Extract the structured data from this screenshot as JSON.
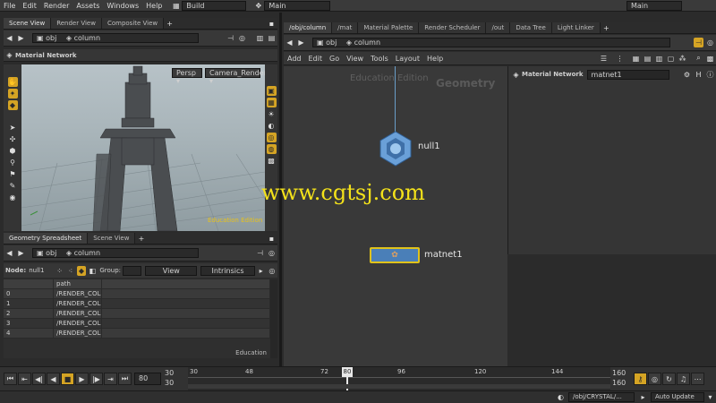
{
  "menubar": {
    "items": [
      "File",
      "Edit",
      "Render",
      "Assets",
      "Windows",
      "Help"
    ],
    "shelf_label": "Build",
    "desktop_label": "Main",
    "right_desktop_label": "Main"
  },
  "left_top": {
    "tabs": [
      "Scene View",
      "Render View",
      "Composite View"
    ],
    "path_label": "obj",
    "path_node": "column",
    "viewer_title": "Material Network",
    "persp_label": "Persp",
    "camera_label": "Camera_Render",
    "watermark": "Education Edition"
  },
  "left_bottom": {
    "tabs": [
      "Geometry Spreadsheet",
      "Scene View"
    ],
    "path_label": "obj",
    "path_node": "column",
    "node_label": "Node:",
    "node_value": "null1",
    "group_label": "Group:",
    "view_label": "View",
    "intrinsics_label": "Intrinsics",
    "column_header": "path",
    "rows": [
      {
        "index": "0",
        "path": "/RENDER_COL"
      },
      {
        "index": "1",
        "path": "/RENDER_COL"
      },
      {
        "index": "2",
        "path": "/RENDER_COL"
      },
      {
        "index": "3",
        "path": "/RENDER_COL"
      },
      {
        "index": "4",
        "path": "/RENDER_COL"
      }
    ],
    "footer": "Education"
  },
  "right": {
    "tabs": [
      "/obj/column",
      "/mat",
      "Material Palette",
      "Render Scheduler",
      "/out",
      "Data Tree",
      "Light Linker"
    ],
    "path_label": "obj",
    "path_node": "column",
    "menu": [
      "Add",
      "Edit",
      "Go",
      "View",
      "Tools",
      "Layout",
      "Help"
    ],
    "network_watermark": "Education Edition",
    "context_label": "Geometry",
    "nodes": {
      "null1": "null1",
      "matnet1": "matnet1"
    },
    "params_title": "Material Network",
    "params_name": "matnet1"
  },
  "overlay_text": "www.cgtsj.com",
  "timeline": {
    "frame": "80",
    "start": "30",
    "start2": "30",
    "ticks": [
      "30",
      "48",
      "72",
      "96",
      "120",
      "144"
    ],
    "current": "80",
    "end": "160",
    "end2": "160"
  },
  "statusbar": {
    "path": "/obj/CRYSTAL/...",
    "update_mode": "Auto Update"
  },
  "colors": {
    "accent": "#d5a424",
    "node_blue": "#4a7fb8",
    "overlay": "#f4e21a"
  }
}
